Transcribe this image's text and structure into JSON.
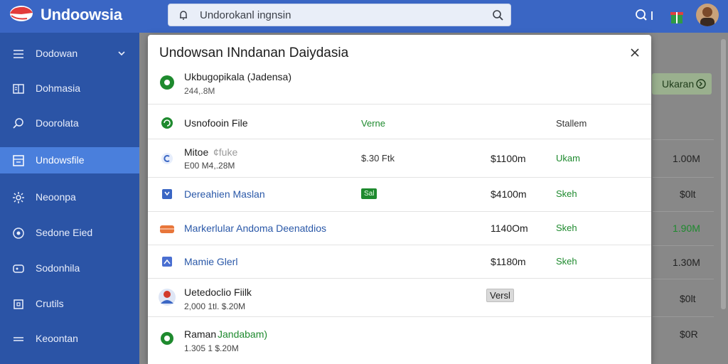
{
  "app": {
    "brand": "Undoowsia"
  },
  "search": {
    "value": "Undorokanl ingnsin"
  },
  "colors": {
    "topbar": "#3a66c4",
    "sidebar": "#2b54a6",
    "sidebar_active": "#4a7fdc",
    "green": "#1e8a2e",
    "blue_link": "#2a58a8"
  },
  "sidebar": {
    "items": [
      {
        "label": "Dodowan",
        "icon": "menu-icon"
      },
      {
        "label": "Dohmasia",
        "icon": "book-icon"
      },
      {
        "label": "Doorolata",
        "icon": "search-icon"
      },
      {
        "label": "Undowsfile",
        "icon": "file-icon",
        "active": true
      },
      {
        "label": "Neoonpa",
        "icon": "gear-icon"
      },
      {
        "label": "Sedone Eied",
        "icon": "settings-circle-icon"
      },
      {
        "label": "Sodonhila",
        "icon": "card-icon"
      },
      {
        "label": "Crutils",
        "icon": "tool-icon"
      },
      {
        "label": "Keoontan",
        "icon": "lines-icon"
      }
    ]
  },
  "background": {
    "button_label": "Ukaran",
    "values": [
      "1.00M",
      "$0lt",
      "1.90M",
      "1.30M",
      "$0lt",
      "$0R"
    ]
  },
  "modal": {
    "title": "Undowsan INndanan Daiydasia",
    "selected": {
      "name": "Ukbugopikala (Jadensa)",
      "sub": "244,.8M"
    },
    "header": {
      "name": "Usnofooin File",
      "col2": "Verne",
      "col4": "Stallem"
    },
    "rows": [
      {
        "name": "Mitoe",
        "name_suffix": "¢fuke",
        "sub": "E00 M4,.28M",
        "col2": "$.30 Ftk",
        "col3": "$1100m",
        "col4": "Ukam"
      },
      {
        "name": "Dereahien Maslan",
        "badge": "Sal",
        "col3": "$4100m",
        "col4": "Skeh"
      },
      {
        "name": "Markerlular Andoma Deenatdios",
        "col3": "1140Om",
        "col4": "Skeh"
      },
      {
        "name": "Mamie Glerl",
        "col3": "$1180m",
        "col4": "Skeh"
      },
      {
        "name": "Uetedoclio Fiilk",
        "sub": "2,000 1tl. $.20M",
        "badge": "Versl"
      },
      {
        "name": "Raman",
        "name_suffix": "Jandabam)",
        "sub": "1.305 1 $.20M"
      }
    ]
  }
}
